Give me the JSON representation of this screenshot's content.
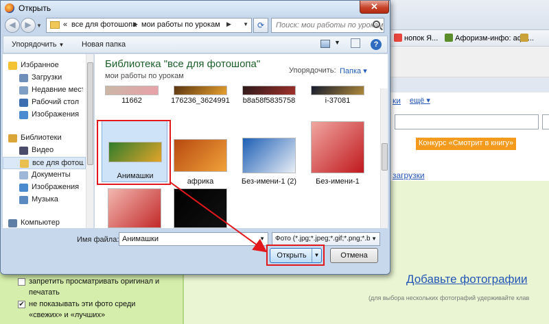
{
  "background": {
    "bookmarks": [
      {
        "label": "нопок Я..."
      },
      {
        "label": "Афоризм-инфо: афо..."
      }
    ],
    "links": {
      "more": "ещё ▾",
      "tail_link": "ки",
      "contest": "Конкурс «Смотрит в книгу»",
      "downloads": "загрузки",
      "add_photos": "Добавьте фотографии",
      "hint": "(для выбора нескольких фотографий удерживайте клав"
    },
    "checkboxes": [
      {
        "label": "запретить просматривать оригинал и",
        "label2": "печатать",
        "checked": false
      },
      {
        "label": "не показывать эти фото среди",
        "label2": "«свежих» и «лучших»",
        "checked": true
      }
    ]
  },
  "dialog": {
    "title": "Открыть",
    "close_glyph": "✕",
    "address": {
      "segments": [
        "«",
        "все для фотошопа",
        "мои работы по урокам"
      ]
    },
    "search_placeholder": "Поиск: мои работы по урокам",
    "toolbar": {
      "organize": "Упорядочить",
      "new_folder": "Новая папка"
    },
    "nav": [
      {
        "label": "Избранное",
        "icon": "star-icon",
        "color": "#f2c232"
      },
      {
        "label": "Загрузки",
        "icon": "downloads-icon",
        "color": "#6e8fb8"
      },
      {
        "label": "Недавние места",
        "icon": "recent-places-icon",
        "color": "#7fa0c4"
      },
      {
        "label": "Рабочий стол",
        "icon": "desktop-icon",
        "color": "#3d6fb0"
      },
      {
        "label": "Изображения",
        "icon": "pictures-icon",
        "color": "#4a8bd0"
      },
      {
        "label": "Библиотеки",
        "icon": "libraries-icon",
        "color": "#d9a637"
      },
      {
        "label": "Видео",
        "icon": "video-icon",
        "color": "#4a4a6a"
      },
      {
        "label": "все для фотошо",
        "icon": "folder-icon",
        "color": "#e9c04f"
      },
      {
        "label": "Документы",
        "icon": "documents-icon",
        "color": "#9fb8d8"
      },
      {
        "label": "Изображения",
        "icon": "pictures-icon",
        "color": "#4a8bd0"
      },
      {
        "label": "Музыка",
        "icon": "music-icon",
        "color": "#5b8ac0"
      },
      {
        "label": "Компьютер",
        "icon": "computer-icon",
        "color": "#5f7ea6"
      }
    ],
    "library": {
      "title": "Библиотека \"все для фотошопа\"",
      "subtitle": "мои работы по урокам",
      "arrange_label": "Упорядочить:",
      "arrange_value": "Папка ▾"
    },
    "files": [
      {
        "name": "11662",
        "c1": "#c9b8a6",
        "c2": "#e9a0a8"
      },
      {
        "name": "176236_3624991",
        "c1": "#5a3410",
        "c2": "#e6a02e"
      },
      {
        "name": "b8a58f5835758",
        "c1": "#2b1a1a",
        "c2": "#a2302c"
      },
      {
        "name": "i-37081",
        "c1": "#141a2e",
        "c2": "#b08a3a"
      },
      {
        "name": "Анимашки",
        "c1": "#2f7d2c",
        "c2": "#e3a42a"
      },
      {
        "name": "африка",
        "c1": "#b84910",
        "c2": "#f0a23a"
      },
      {
        "name": "Без-имени-1 (2)",
        "c1": "#1d5fb5",
        "c2": "#e9eef6"
      },
      {
        "name": "Без-имени-1",
        "c1": "#f0a6a0",
        "c2": "#c0191e"
      },
      {
        "name": "",
        "c1": "#f3b7b0",
        "c2": "#c22a2a"
      },
      {
        "name": "",
        "c1": "#000000",
        "c2": "#111111"
      }
    ],
    "filename_label": "Имя файла:",
    "filename_value": "Анимашки",
    "filetype_value": "Фото (*.jpg;*.jpeg;*.gif;*.png;*.b",
    "open_label": "Открыть",
    "cancel_label": "Отмена"
  }
}
